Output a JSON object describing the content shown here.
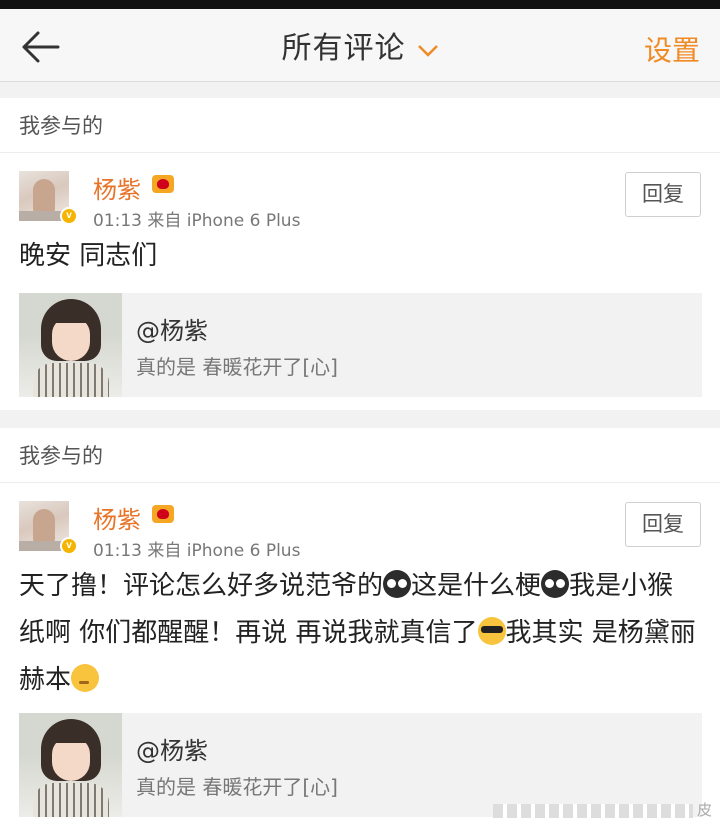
{
  "navbar": {
    "title": "所有评论",
    "settings_label": "设置"
  },
  "cards": [
    {
      "section_label": "我参与的",
      "username": "杨紫",
      "time": "01:13",
      "source": "来自 iPhone 6 Plus",
      "reply_label": "回复",
      "comment_text": "晚安 同志们",
      "quote": {
        "mention": "@杨紫",
        "text": "真的是 春暖花开了[心]"
      }
    },
    {
      "section_label": "我参与的",
      "username": "杨紫",
      "time": "01:13",
      "source": "来自 iPhone 6 Plus",
      "reply_label": "回复",
      "comment_parts": [
        "天了撸！评论怎么好多说范爷的",
        "这是什么梗",
        "我是小猴纸啊 你们都醒醒！再说 再说我就真信了",
        "我其实 是杨黛丽 赫本"
      ],
      "quote": {
        "mention": "@杨紫",
        "text": "真的是 春暖花开了[心]"
      }
    }
  ],
  "watermark": "皮",
  "colors": {
    "accent": "#f08a24",
    "username": "#e8742a",
    "verified": "#f5b400"
  },
  "icons": [
    "back-arrow-icon",
    "chevron-down-icon",
    "verified-icon",
    "member-crown-icon",
    "emoji-dark-face-icon",
    "emoji-sunglasses-icon",
    "emoji-thinking-icon"
  ]
}
